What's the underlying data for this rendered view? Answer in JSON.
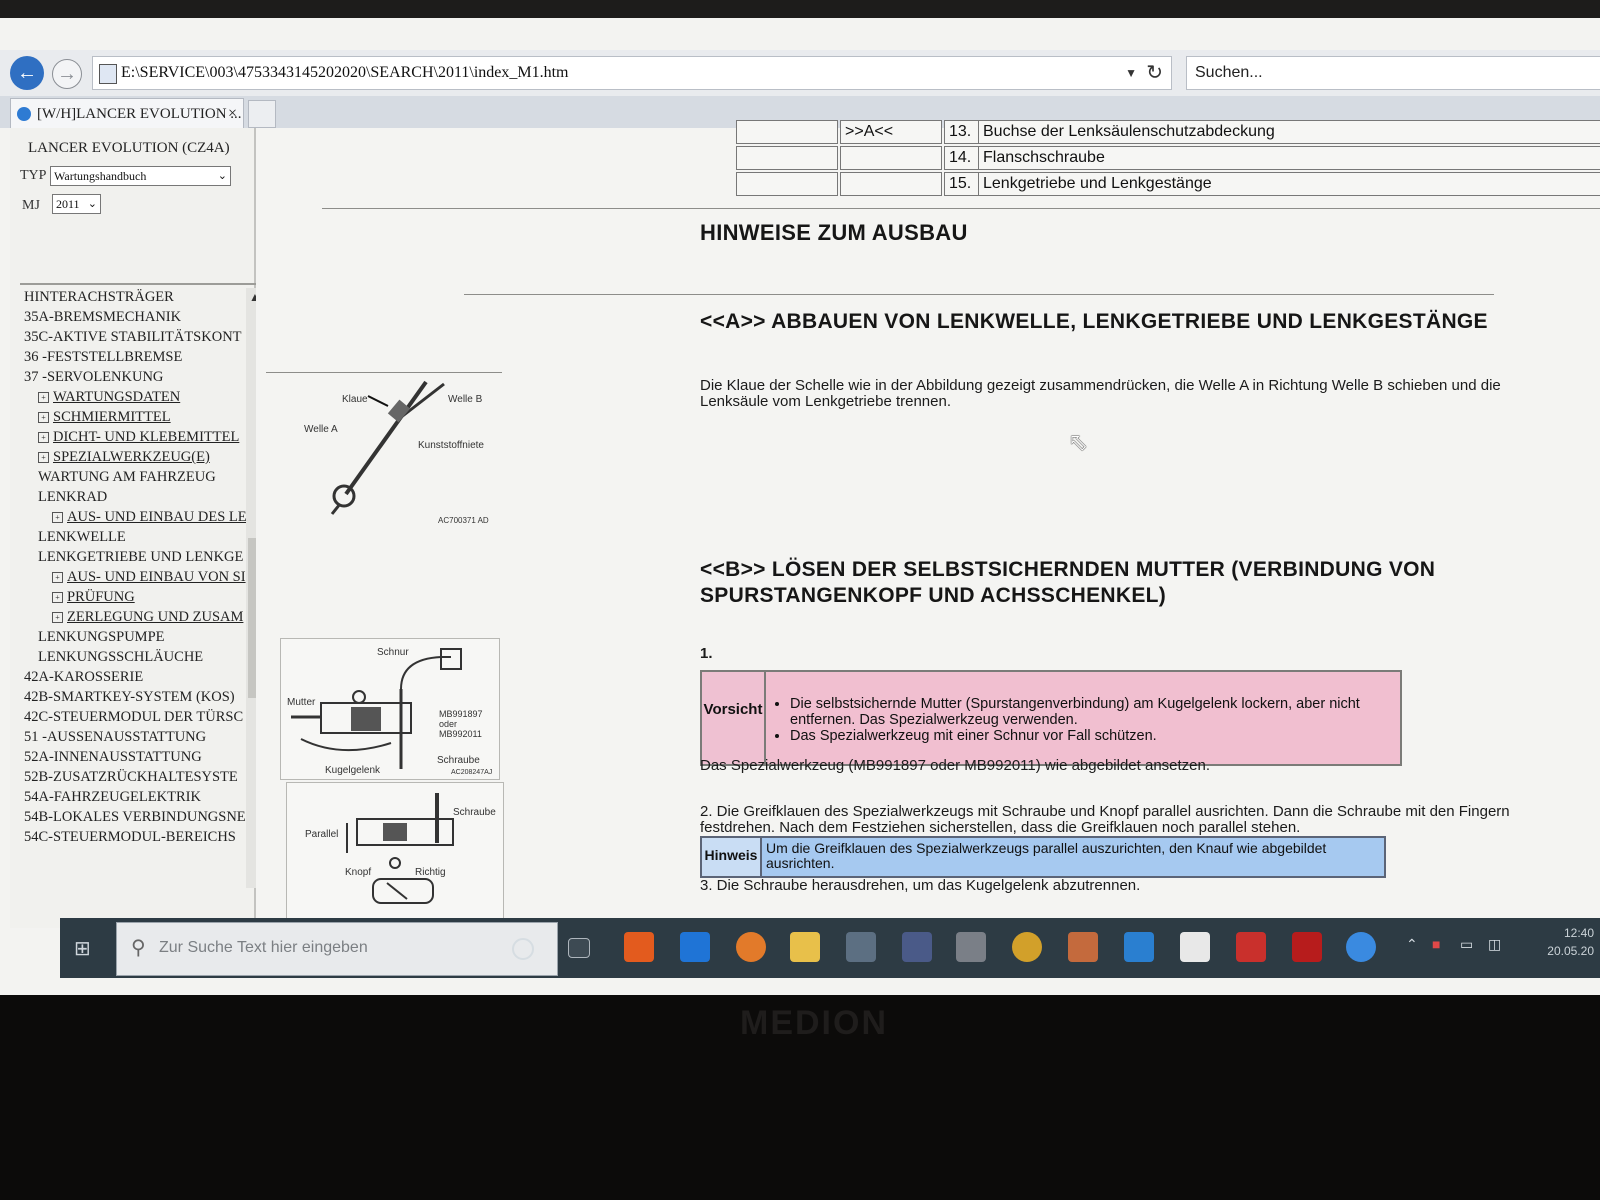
{
  "browser": {
    "url": "E:\\SERVICE\\003\\4753343145202020\\SEARCH\\2011\\index_M1.htm",
    "search_placeholder": "Suchen...",
    "tab_title": "[W/H]LANCER EVOLUTION ...",
    "tab_close": "×"
  },
  "sidebar": {
    "model": "LANCER EVOLUTION (CZ4A)",
    "typ_label": "TYP",
    "typ_value": "Wartungshandbuch",
    "mj_label": "MJ",
    "mj_value": "2011",
    "tree": [
      {
        "label": "HINTERACHSTRÄGER",
        "indent": 0,
        "link": false,
        "box": false
      },
      {
        "label": "35A-BREMSMECHANIK",
        "indent": 0,
        "link": false,
        "box": false
      },
      {
        "label": "35C-AKTIVE STABILITÄTSKONT",
        "indent": 0,
        "link": false,
        "box": false
      },
      {
        "label": "36 -FESTSTELLBREMSE",
        "indent": 0,
        "link": false,
        "box": false
      },
      {
        "label": "37 -SERVOLENKUNG",
        "indent": 0,
        "link": false,
        "box": false
      },
      {
        "label": "WARTUNGSDATEN",
        "indent": 1,
        "link": true,
        "box": true
      },
      {
        "label": "SCHMIERMITTEL",
        "indent": 1,
        "link": true,
        "box": true
      },
      {
        "label": "DICHT- UND KLEBEMITTEL",
        "indent": 1,
        "link": true,
        "box": true
      },
      {
        "label": "SPEZIALWERKZEUG(E)",
        "indent": 1,
        "link": true,
        "box": true
      },
      {
        "label": "WARTUNG AM FAHRZEUG",
        "indent": 1,
        "link": false,
        "box": false
      },
      {
        "label": "LENKRAD",
        "indent": 1,
        "link": false,
        "box": false
      },
      {
        "label": "AUS- UND EINBAU DES LE",
        "indent": 2,
        "link": true,
        "box": true
      },
      {
        "label": "LENKWELLE",
        "indent": 1,
        "link": false,
        "box": false
      },
      {
        "label": "LENKGETRIEBE UND LENKGE",
        "indent": 1,
        "link": false,
        "box": false
      },
      {
        "label": "AUS- UND EINBAU VON SI",
        "indent": 2,
        "link": true,
        "box": true
      },
      {
        "label": "PRÜFUNG",
        "indent": 2,
        "link": true,
        "box": true
      },
      {
        "label": "ZERLEGUNG UND ZUSAM",
        "indent": 2,
        "link": true,
        "box": true
      },
      {
        "label": "LENKUNGSPUMPE",
        "indent": 1,
        "link": false,
        "box": false
      },
      {
        "label": "LENKUNGSSCHLÄUCHE",
        "indent": 1,
        "link": false,
        "box": false
      },
      {
        "label": "42A-KAROSSERIE",
        "indent": 0,
        "link": false,
        "box": false
      },
      {
        "label": "42B-SMARTKEY-SYSTEM (KOS)",
        "indent": 0,
        "link": false,
        "box": false
      },
      {
        "label": "42C-STEUERMODUL DER TÜRSC",
        "indent": 0,
        "link": false,
        "box": false
      },
      {
        "label": "51 -AUSSENAUSSTATTUNG",
        "indent": 0,
        "link": false,
        "box": false
      },
      {
        "label": "52A-INNENAUSSTATTUNG",
        "indent": 0,
        "link": false,
        "box": false
      },
      {
        "label": "52B-ZUSATZRÜCKHALTESYSTE",
        "indent": 0,
        "link": false,
        "box": false
      },
      {
        "label": "54A-FAHRZEUGELEKTRIK",
        "indent": 0,
        "link": false,
        "box": false
      },
      {
        "label": "54B-LOKALES VERBINDUNGSNE",
        "indent": 0,
        "link": false,
        "box": false
      },
      {
        "label": "54C-STEUERMODUL-BEREICHS",
        "indent": 0,
        "link": false,
        "box": false
      }
    ]
  },
  "parts_table": [
    {
      "c1": "",
      "c2": ">>A<<",
      "num": "13.",
      "name": "Buchse der Lenksäulenschutzabdeckung"
    },
    {
      "c1": "",
      "c2": "",
      "num": "14.",
      "name": "Flanschschraube"
    },
    {
      "c1": "",
      "c2": "",
      "num": "15.",
      "name": "Lenkgetriebe und Lenkgestänge"
    }
  ],
  "content": {
    "heading_main": "HINWEISE ZUM AUSBAU",
    "section_a_title": "<<A>> ABBAUEN VON LENKWELLE, LENKGETRIEBE UND LENKGESTÄNGE",
    "section_a_text": "Die Klaue der Schelle wie in der Abbildung gezeigt zusammendrücken, die Welle A in Richtung Welle B schieben und die Lenksäule vom Lenkgetriebe trennen.",
    "section_b_title_1": "<<B>> LÖSEN DER SELBSTSICHERNDEN MUTTER (VERBINDUNG VON",
    "section_b_title_2": "SPURSTANGENKOPF UND ACHSSCHENKEL)",
    "step1": "1.",
    "caution_label": "Vorsicht",
    "caution_items": [
      "Die selbstsichernde Mutter (Spurstangenverbindung) am Kugelgelenk lockern, aber nicht entfernen. Das Spezialwerkzeug verwenden.",
      "Das Spezialwerkzeug mit einer Schnur vor Fall schützen."
    ],
    "step1_text": "Das Spezialwerkzeug (MB991897 oder MB992011) wie abgebildet ansetzen.",
    "step2_text": "2. Die Greifklauen des Spezialwerkzeugs mit Schraube und Knopf parallel ausrichten. Dann die Schraube mit den Fingern festdrehen. Nach dem Festziehen sicherstellen, dass die Greifklauen noch parallel stehen.",
    "hint_label": "Hinweis",
    "hint_text": "Um die Greifklauen des Spezialwerkzeugs parallel auszurichten, den Knauf wie abgebildet ausrichten.",
    "step3_text": "3. Die Schraube herausdrehen, um das Kugelgelenk abzutrennen."
  },
  "figures": {
    "fig1": {
      "klaue": "Klaue",
      "welle_b": "Welle B",
      "welle_a": "Welle A",
      "kunststoffniete": "Kunststoffniete",
      "code": "AC700371 AD"
    },
    "fig2": {
      "schnur": "Schnur",
      "mutter": "Mutter",
      "tool": "MB991897 oder MB992011",
      "schraube": "Schraube",
      "kugelgelenk": "Kugelgelenk",
      "code": "AC208247AJ"
    },
    "fig3": {
      "schraube": "Schraube",
      "parallel": "Parallel",
      "knopf": "Knopf",
      "richtig": "Richtig"
    }
  },
  "taskbar": {
    "search_placeholder": "Zur Suche Text hier eingeben",
    "clock_time": "12:40",
    "clock_date": "20.05.20"
  },
  "monitor_brand": "MEDION",
  "icons": [
    "back-arrow-icon",
    "forward-arrow-icon",
    "refresh-icon",
    "windows-start-icon",
    "search-icon",
    "cortana-icon",
    "task-view-icon",
    "office-icon",
    "edge-icon",
    "firefox-icon",
    "file-explorer-icon",
    "store-icon",
    "photos-icon",
    "media-icon",
    "chrome-icon",
    "app-icon",
    "mail-icon",
    "security-icon",
    "acrobat-icon",
    "mitsubishi-icon",
    "ie-icon"
  ]
}
